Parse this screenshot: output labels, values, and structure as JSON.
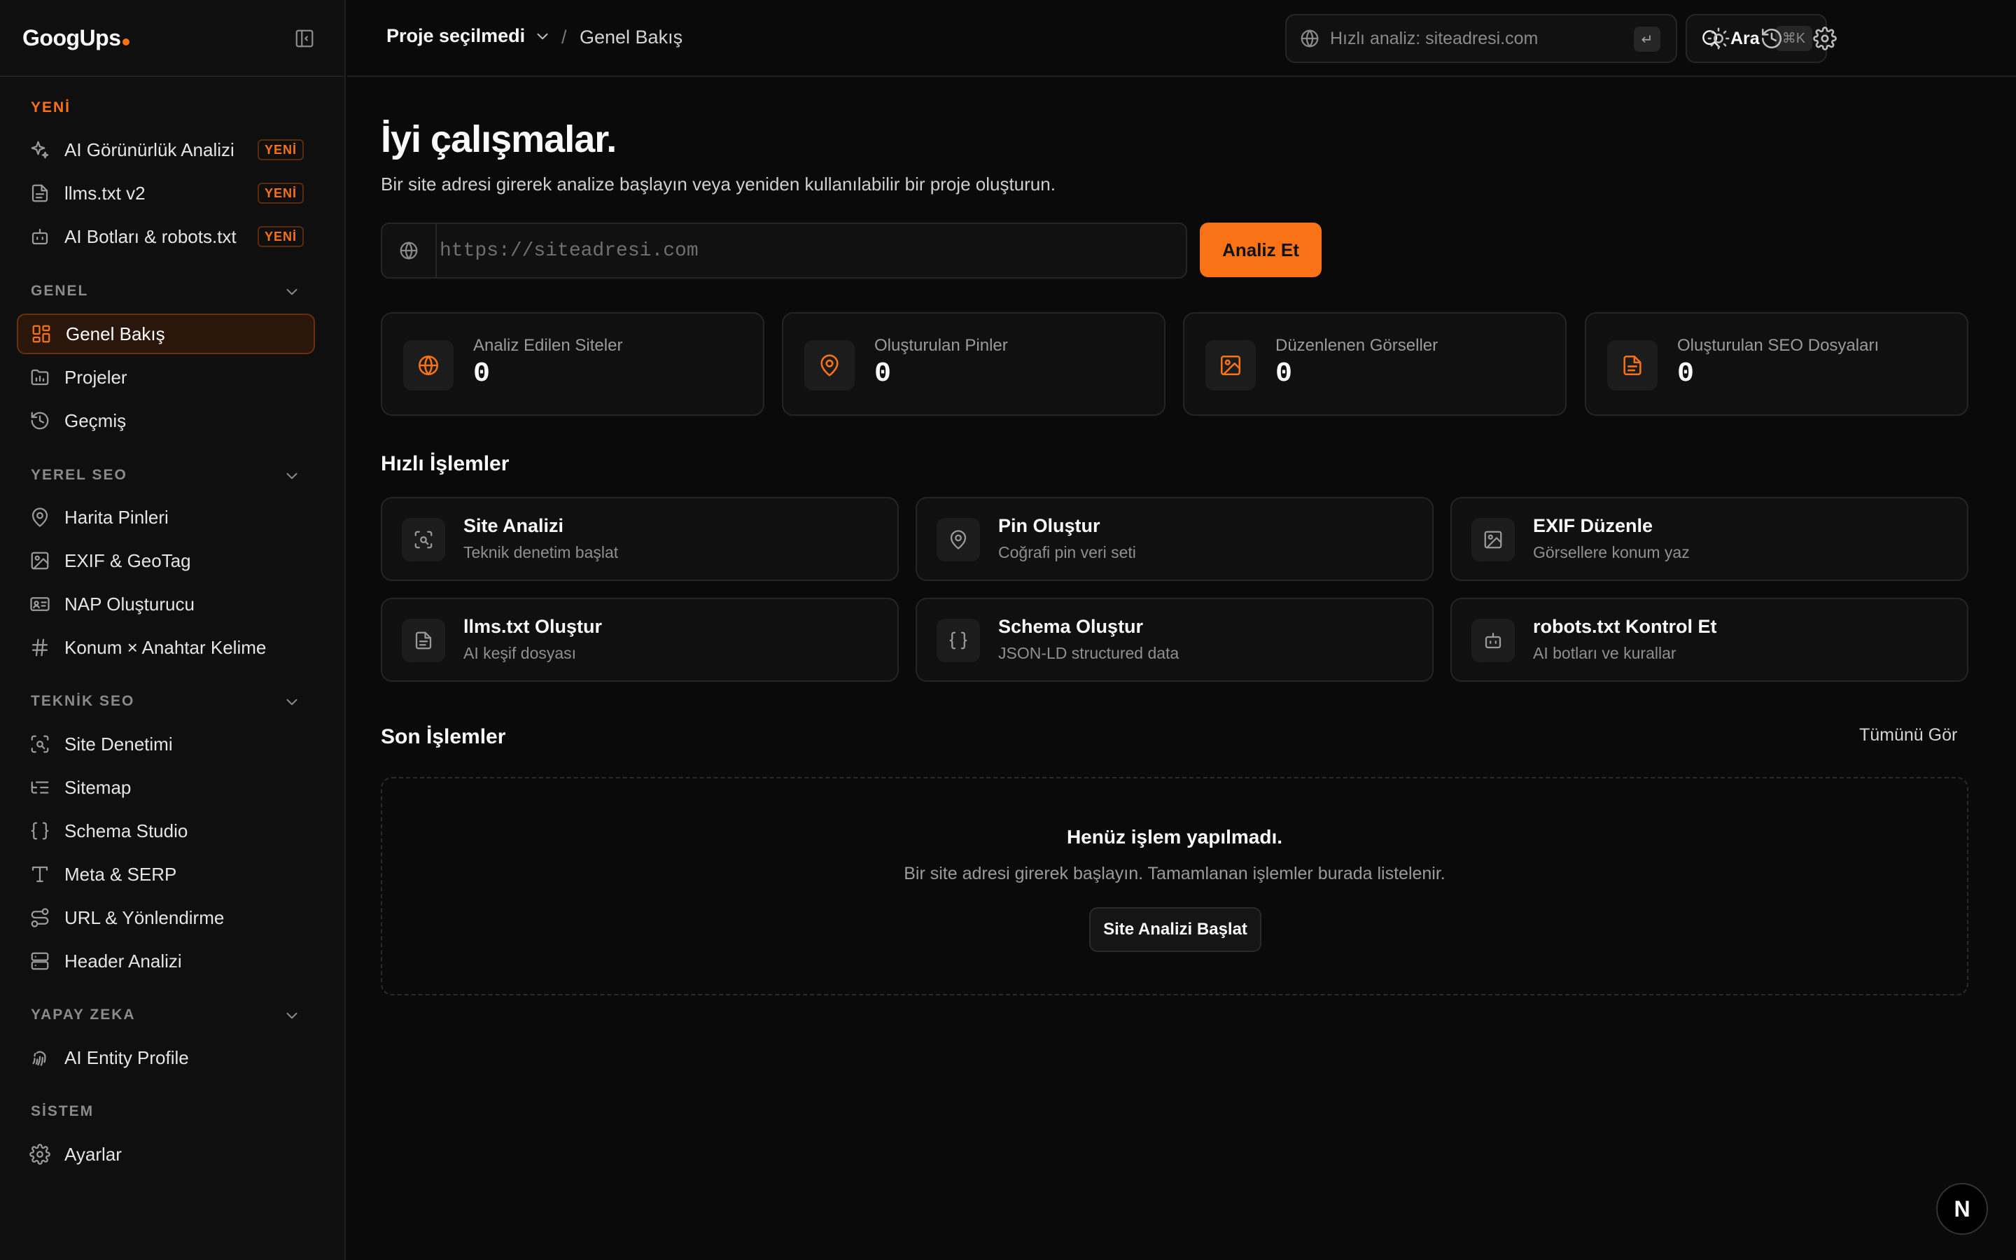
{
  "app": {
    "logo": "GoogUps"
  },
  "sidebar": {
    "sections": {
      "new": "YENİ",
      "general": "GENEL",
      "local": "YEREL SEO",
      "technical": "TEKNİK SEO",
      "ai": "YAPAY ZEKA",
      "system": "SİSTEM"
    },
    "badge": "YENİ",
    "items": {
      "ai_visibility": "AI Görünürlük Analizi",
      "llms": "llms.txt v2",
      "ai_bots": "AI Botları & robots.txt",
      "overview": "Genel Bakış",
      "projects": "Projeler",
      "history": "Geçmiş",
      "map_pins": "Harita Pinleri",
      "exif": "EXIF & GeoTag",
      "nap": "NAP Oluşturucu",
      "location_keyword": "Konum × Anahtar Kelime",
      "site_audit": "Site Denetimi",
      "sitemap": "Sitemap",
      "schema": "Schema Studio",
      "meta": "Meta & SERP",
      "url": "URL & Yönlendirme",
      "header": "Header Analizi",
      "entity": "AI Entity Profile",
      "settings": "Ayarlar"
    }
  },
  "topbar": {
    "project": "Proje seçilmedi",
    "breadcrumb_sep": "/",
    "breadcrumb": "Genel Bakış",
    "quick_placeholder": "Hızlı analiz: siteadresi.com",
    "enter_key": "↵",
    "search_label": "Ara",
    "search_kbd": "⌘K"
  },
  "main": {
    "greeting": "İyi çalışmalar.",
    "subtitle": "Bir site adresi girerek analize başlayın veya yeniden kullanılabilir bir proje oluşturun.",
    "url_placeholder": "https://siteadresi.com",
    "analyze_label": "Analiz Et",
    "stats": [
      {
        "label": "Analiz Edilen Siteler",
        "value": "0"
      },
      {
        "label": "Oluşturulan Pinler",
        "value": "0"
      },
      {
        "label": "Düzenlenen Görseller",
        "value": "0"
      },
      {
        "label": "Oluşturulan SEO Dosyaları",
        "value": "0"
      }
    ],
    "quick_actions_title": "Hızlı İşlemler",
    "quick_actions": [
      {
        "title": "Site Analizi",
        "sub": "Teknik denetim başlat"
      },
      {
        "title": "Pin Oluştur",
        "sub": "Coğrafi pin veri seti"
      },
      {
        "title": "EXIF Düzenle",
        "sub": "Görsellere konum yaz"
      },
      {
        "title": "llms.txt Oluştur",
        "sub": "AI keşif dosyası"
      },
      {
        "title": "Schema Oluştur",
        "sub": "JSON-LD structured data"
      },
      {
        "title": "robots.txt Kontrol Et",
        "sub": "AI botları ve kurallar"
      }
    ],
    "recent_title": "Son İşlemler",
    "see_all": "Tümünü Gör",
    "empty_title": "Henüz işlem yapılmadı.",
    "empty_sub": "Bir site adresi girerek başlayın. Tamamlanan işlemler burada listelenir.",
    "empty_button": "Site Analizi Başlat"
  },
  "misc": {
    "n_badge": "N"
  },
  "colors": {
    "accent": "#f97316",
    "background": "#0a0a0a",
    "sidebar": "#0f0f0f"
  }
}
